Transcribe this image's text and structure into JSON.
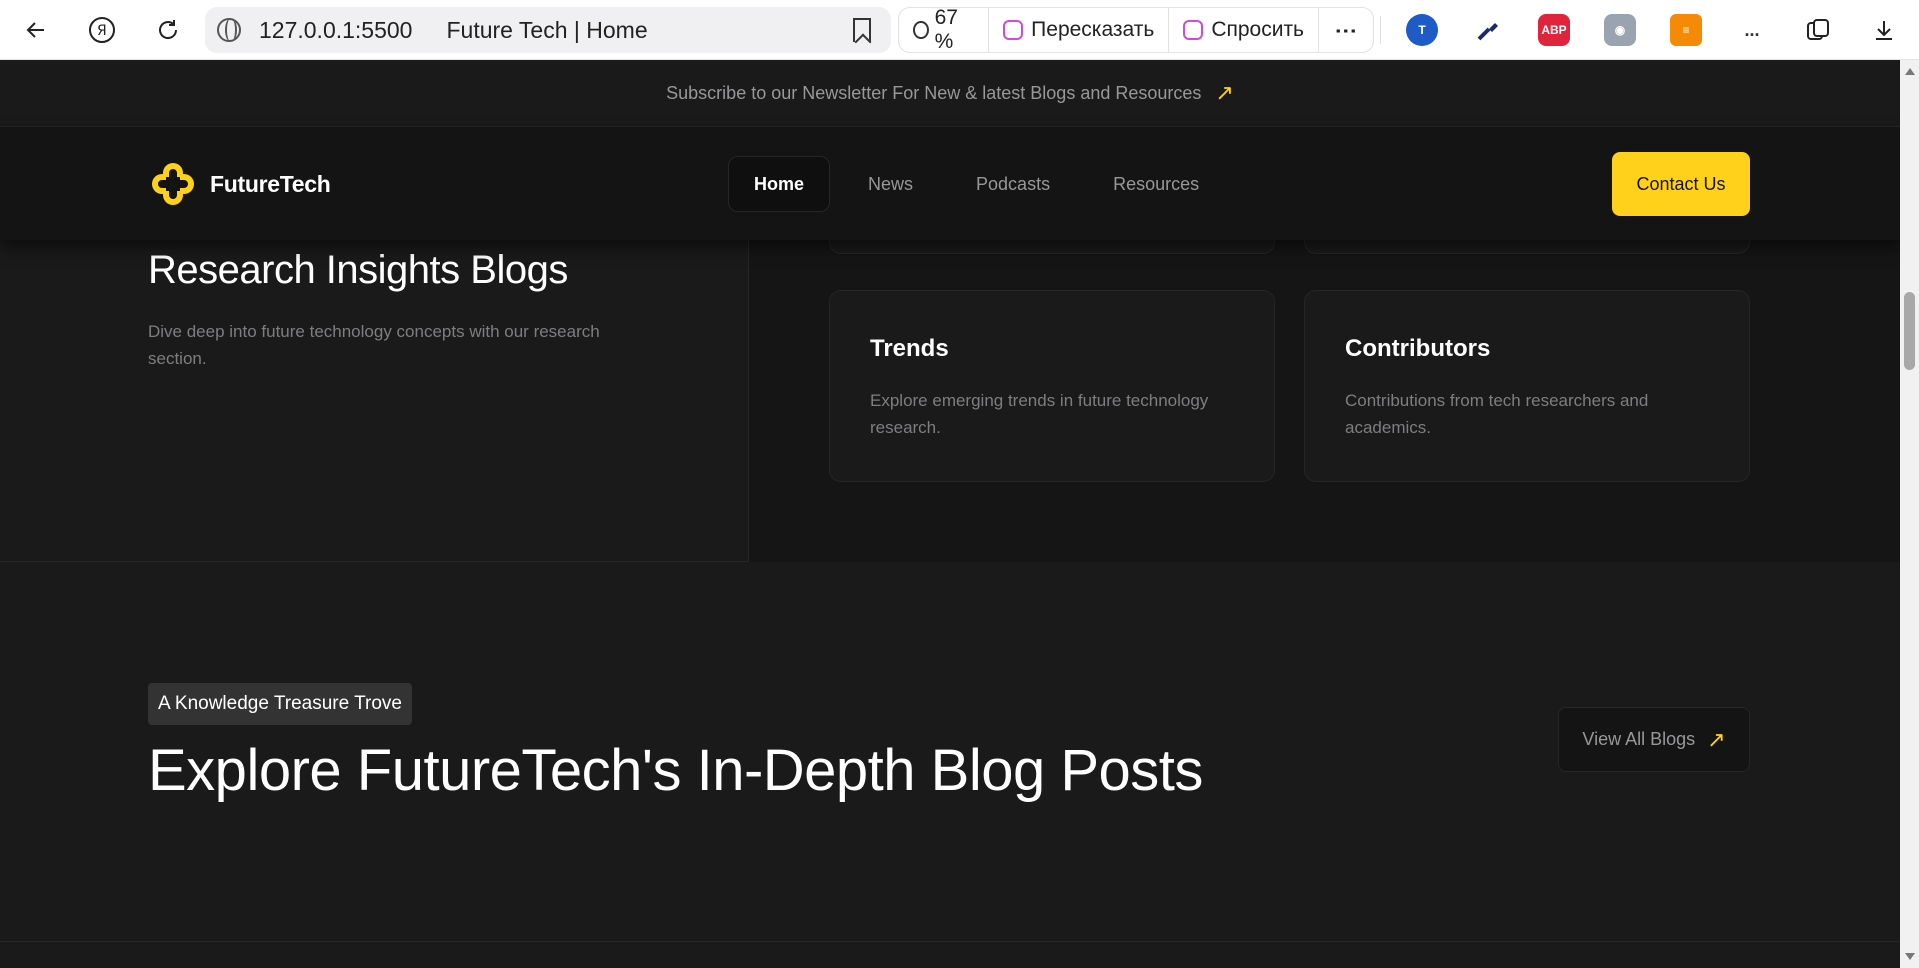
{
  "browser": {
    "url": "127.0.0.1:5500",
    "page_title": "Future Tech | Home",
    "zoom": "67 %",
    "retell_label": "Пересказать",
    "ask_label": "Спросить",
    "more_label": "...",
    "extensions": [
      "translate-icon",
      "eyedropper-icon",
      "adblock-icon",
      "shield-icon",
      "reader-icon"
    ],
    "abp_label": "ABP"
  },
  "newsletter": {
    "text": "Subscribe to our Newsletter For New & latest Blogs and Resources",
    "arrow": "↗"
  },
  "navbar": {
    "logo_text": "FutureTech",
    "links": [
      "Home",
      "News",
      "Podcasts",
      "Resources"
    ],
    "active": "Home",
    "contact_label": "Contact Us"
  },
  "research": {
    "title": "Research Insights Blogs",
    "description": "Dive deep into future technology concepts with our research section.",
    "cards": [
      {
        "title": "Trends",
        "text": "Explore emerging trends in future technology research."
      },
      {
        "title": "Contributors",
        "text": "Contributions from tech researchers and academics."
      }
    ]
  },
  "blogs": {
    "tag": "A Knowledge Treasure Trove",
    "title": "Explore FutureTech's In-Depth Blog Posts",
    "view_all_label": "View All Blogs",
    "arrow": "↗"
  },
  "colors": {
    "accent": "#ffd11a",
    "bg": "#1a1a1a",
    "muted_text": "#98989a"
  }
}
